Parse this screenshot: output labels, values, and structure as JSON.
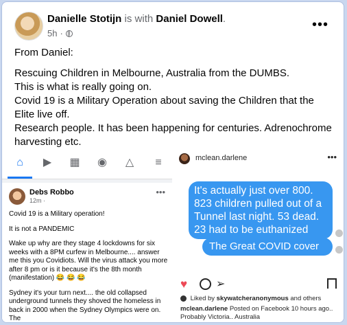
{
  "post": {
    "author": "Danielle Stotijn",
    "with_text": "is with",
    "tagged": "Daniel Dowell",
    "period": ".",
    "time": "5h",
    "dot": "·",
    "more": "•••",
    "lines": [
      "From Daniel:",
      "Rescuing Children in Melbourne, Australia from the DUMBS.",
      "This is what is really going on.",
      "Covid 19 is a Military Operation about saving the Children that the Elite live off.",
      "Research people. It has been happening for centuries. Adrenochrome harvesting etc."
    ]
  },
  "left_screenshot": {
    "nav_icons": [
      "home-icon",
      "video-icon",
      "marketplace-icon",
      "profile-icon",
      "bell-icon",
      "menu-icon"
    ],
    "author": "Debs Robbo",
    "meta": "12m ·",
    "more": "•••",
    "paragraphs": [
      "Covid 19 is a Military operation!",
      "It is not a PANDEMIC",
      "Wake up why are they stage 4 lockdowns for six weeks with a 8PM curfew in Melbourne.... answer me this you Covidiots. Will the virus attack you more after 8 pm or is it because it's the 8th month (manifestation) 😂 😂 😂",
      "Sydney it's your turn next.... the old collapsed underground tunnels they shoved the homeless in back in 2000 when the Sydney Olympics were on. The"
    ]
  },
  "right_screenshot": {
    "username": "mclean.darlene",
    "more": "•••",
    "bubble1": "It's actually just over 800. 823 children pulled out of a Tunnel last night. 53 dead. 23 had to be euthanized",
    "bubble2": "The Great COVID cover up",
    "liked_prefix": "Liked by",
    "liked_user": "skywatcheranonymous",
    "liked_suffix": "and others",
    "caption_user": "mclean.darlene",
    "caption_text": "Posted on Facebook 10 hours ago.. Probably Victoria.. Australia"
  },
  "colors": {
    "bubble": "#3897f0",
    "fb_blue": "#1877f2",
    "heart": "#ed4956"
  }
}
